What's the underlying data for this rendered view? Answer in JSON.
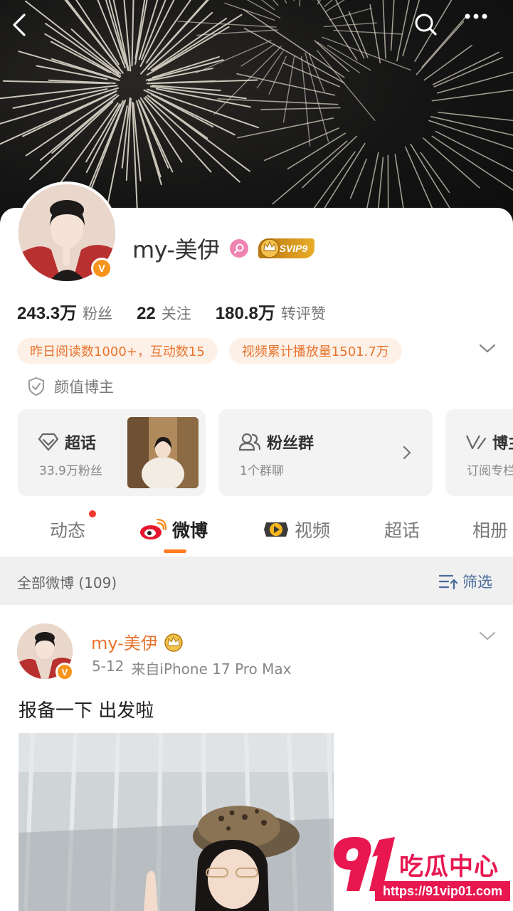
{
  "header": {
    "back_icon": "back-arrow-icon",
    "search_icon": "search-icon",
    "more_icon": "more-dots-icon"
  },
  "profile": {
    "username": "my-美伊",
    "svip_label": "SVIP9",
    "verified_mark": "V",
    "stats": [
      {
        "value": "243.3万",
        "label": "粉丝"
      },
      {
        "value": "22",
        "label": "关注"
      },
      {
        "value": "180.8万",
        "label": "转评赞"
      }
    ],
    "tags": [
      "昨日阅读数1000+，互动数15",
      "视频累计播放量1501.7万"
    ],
    "verification": "颜值博主"
  },
  "features": {
    "chaohua": {
      "title": "超话",
      "sub": "33.9万粉丝"
    },
    "fans_group": {
      "title": "粉丝群",
      "sub": "1个群聊"
    },
    "blogger": {
      "title": "博主",
      "sub": "订阅专栏"
    }
  },
  "tabs": [
    {
      "label": "动态"
    },
    {
      "label": "微博"
    },
    {
      "label": "视频"
    },
    {
      "label": "超话"
    },
    {
      "label": "相册"
    }
  ],
  "filter": {
    "title": "全部微博 (109)",
    "button": "筛选"
  },
  "post": {
    "name": "my-美伊",
    "date": "5-12",
    "source": "来自iPhone 17 Pro Max",
    "text": "报备一下 出发啦"
  },
  "watermark": {
    "brand_num": "91",
    "brand_cn": "吃瓜中心",
    "url": "https://91vip01.com"
  },
  "colors": {
    "accent": "#e8742f",
    "tag_bg": "#fdf1e7",
    "verified": "#f7941d",
    "svip_gold": "#d99a1f",
    "filter_blue": "#4a6a9a",
    "watermark": "#e8174f"
  }
}
